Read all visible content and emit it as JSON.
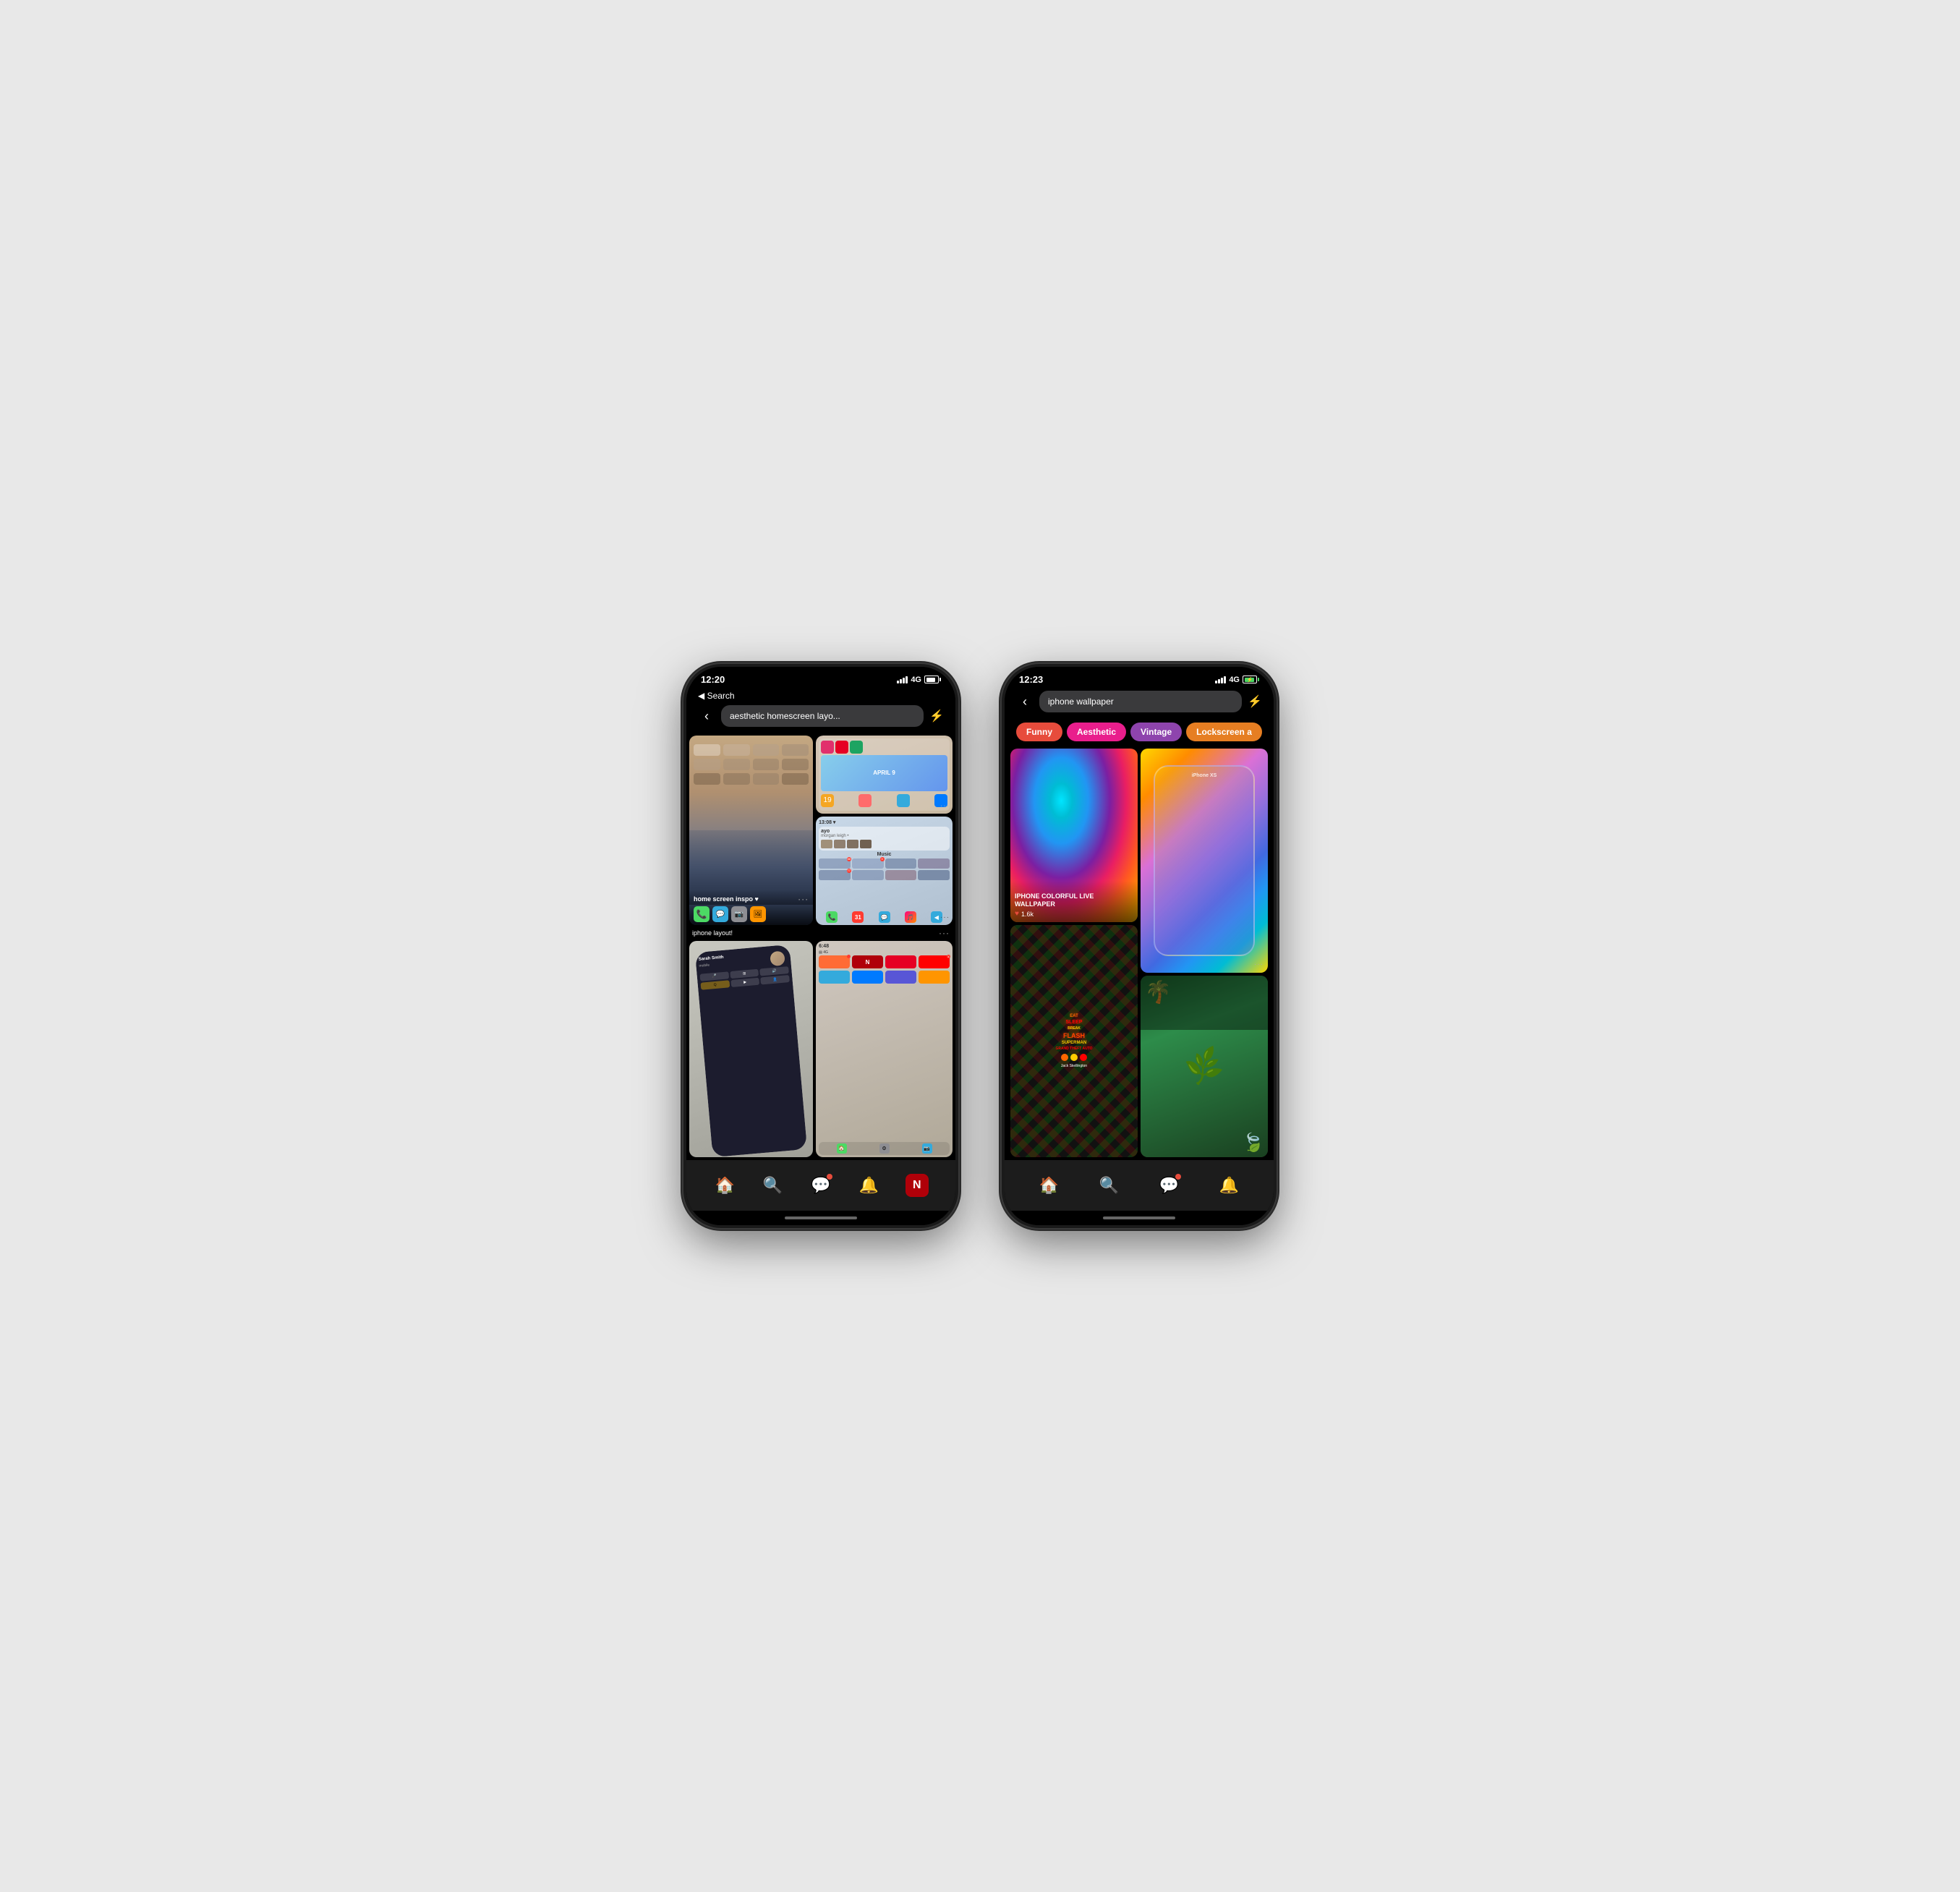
{
  "phone_left": {
    "status": {
      "time": "12:20",
      "network": "4G"
    },
    "back_label": "◀ Search",
    "search_query": "aesthetic homescreen layo...",
    "filter_icon": "⚙",
    "pins": [
      {
        "id": "homescreen",
        "title": "home screen inspo ♥",
        "type": "homescreen"
      },
      {
        "id": "layout1",
        "title": "",
        "type": "iphone_layout_top"
      },
      {
        "id": "music",
        "title": "iphone layout!",
        "type": "music"
      },
      {
        "id": "hand",
        "title": "",
        "type": "hand"
      },
      {
        "id": "netflix",
        "title": "",
        "type": "netflix"
      }
    ],
    "dock": {
      "items": [
        "🏠",
        "🔍",
        "💬",
        "🔔",
        "N"
      ]
    }
  },
  "phone_right": {
    "status": {
      "time": "12:23",
      "network": "4G"
    },
    "back_label": "",
    "search_query": "iphone wallpaper",
    "filter_icon": "⚙",
    "chips": [
      {
        "label": "Funny",
        "color": "red"
      },
      {
        "label": "Aesthetic",
        "color": "pink"
      },
      {
        "label": "Vintage",
        "color": "purple"
      },
      {
        "label": "Lockscreen a",
        "color": "orange"
      }
    ],
    "pins": [
      {
        "col": 0,
        "id": "space",
        "title": "IPHONE COLORFUL LIVE WALLPAPER",
        "likes": "1.6k",
        "type": "space",
        "height": "tall"
      },
      {
        "col": 1,
        "id": "marble",
        "title": "",
        "type": "marble",
        "height": "tall"
      },
      {
        "col": 0,
        "id": "sticker",
        "title": "",
        "type": "sticker",
        "height": "medium"
      },
      {
        "col": 1,
        "id": "tropical",
        "title": "",
        "type": "tropical",
        "height": "medium"
      }
    ],
    "dock": {
      "items": [
        "🏠",
        "🔍",
        "💬",
        "🔔"
      ]
    }
  }
}
